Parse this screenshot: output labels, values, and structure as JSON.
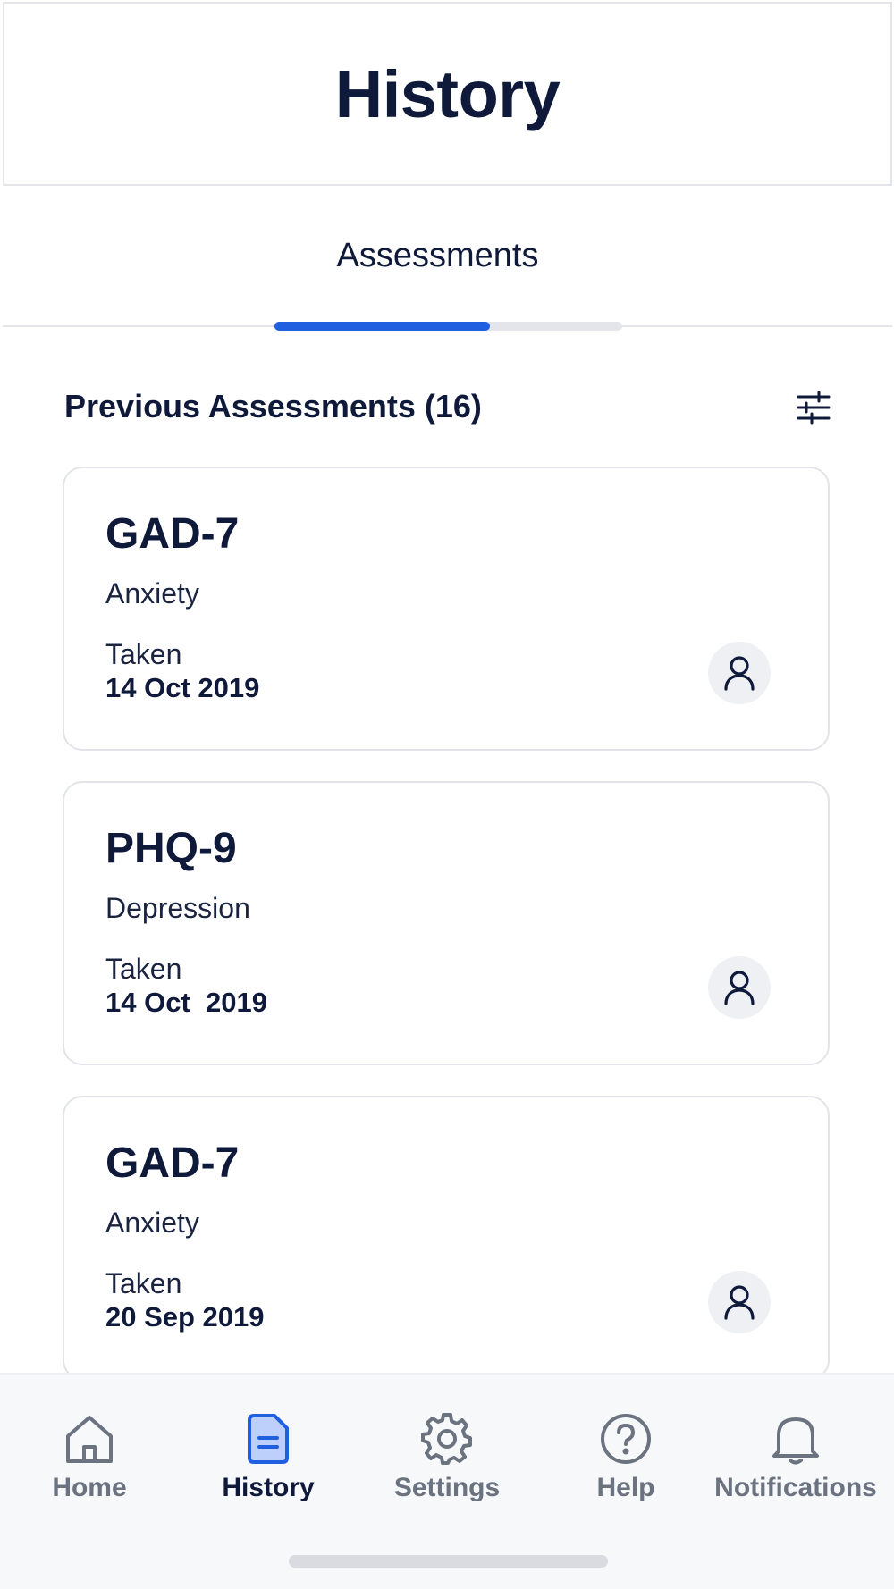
{
  "header": {
    "title": "History"
  },
  "tabs": [
    {
      "label": "Assessments",
      "active": true
    }
  ],
  "tab_progress": 0.62,
  "section": {
    "title": "Previous Assessments (16)"
  },
  "assessments": [
    {
      "code": "GAD-7",
      "category": "Anxiety",
      "taken_label": "Taken",
      "date": "14 Oct 2019"
    },
    {
      "code": "PHQ-9",
      "category": "Depression",
      "taken_label": "Taken",
      "date": "14 Oct  2019"
    },
    {
      "code": "GAD-7",
      "category": "Anxiety",
      "taken_label": "Taken",
      "date": "20 Sep 2019"
    }
  ],
  "nav": {
    "items": [
      {
        "label": "Home",
        "icon": "home-icon"
      },
      {
        "label": "History",
        "icon": "history-icon",
        "active": true
      },
      {
        "label": "Settings",
        "icon": "gear-icon"
      },
      {
        "label": "Help",
        "icon": "help-icon"
      },
      {
        "label": "Notifications",
        "icon": "bell-icon"
      }
    ]
  },
  "colors": {
    "accent": "#1f5fe0",
    "text": "#0f1a3a",
    "muted": "#6b7280",
    "border": "#e2e4e9",
    "nav_bg": "#f7f8fa"
  }
}
